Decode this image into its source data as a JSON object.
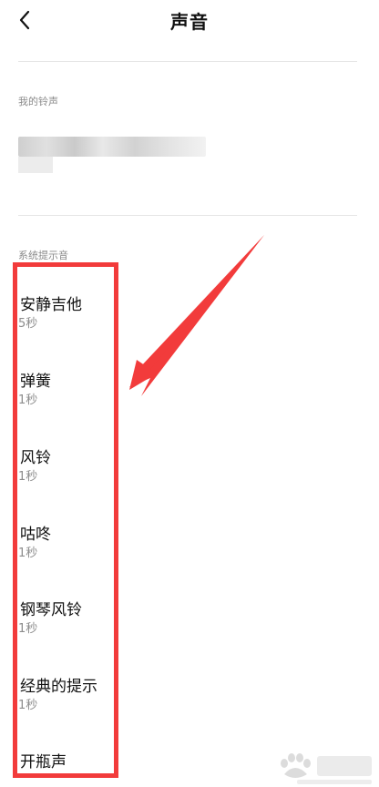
{
  "header": {
    "title": "声音",
    "back_icon": "chevron-left-icon"
  },
  "sections": {
    "my_ringtones": {
      "label": "我的铃声"
    },
    "system_tones": {
      "label": "系统提示音",
      "items": [
        {
          "name": "安静吉他",
          "duration": "5秒"
        },
        {
          "name": "弹簧",
          "duration": "1秒"
        },
        {
          "name": "风铃",
          "duration": "1秒"
        },
        {
          "name": "咕咚",
          "duration": "1秒"
        },
        {
          "name": "钢琴风铃",
          "duration": "1秒"
        },
        {
          "name": "经典的提示",
          "duration": "1秒"
        },
        {
          "name": "开瓶声",
          "duration": ""
        }
      ]
    }
  },
  "annotation": {
    "color": "#f23b3b"
  },
  "watermark": {
    "icon": "paw-logo-icon"
  }
}
